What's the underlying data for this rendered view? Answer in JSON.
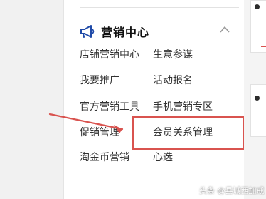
{
  "menu": {
    "section_title": "营销中心",
    "items": [
      "店铺营销中心",
      "生意参谋",
      "我要推广",
      "活动报名",
      "官方营销工具",
      "手机营销专区",
      "促销管理",
      "会员关系管理",
      "淘金币营销",
      "心选"
    ]
  },
  "annotation": {
    "highlight_color": "#d9534f"
  },
  "watermark": {
    "text": "头条 @县城西加戒"
  },
  "icons": {
    "section": "megaphone-icon",
    "collapse": "chevron-up-icon"
  }
}
